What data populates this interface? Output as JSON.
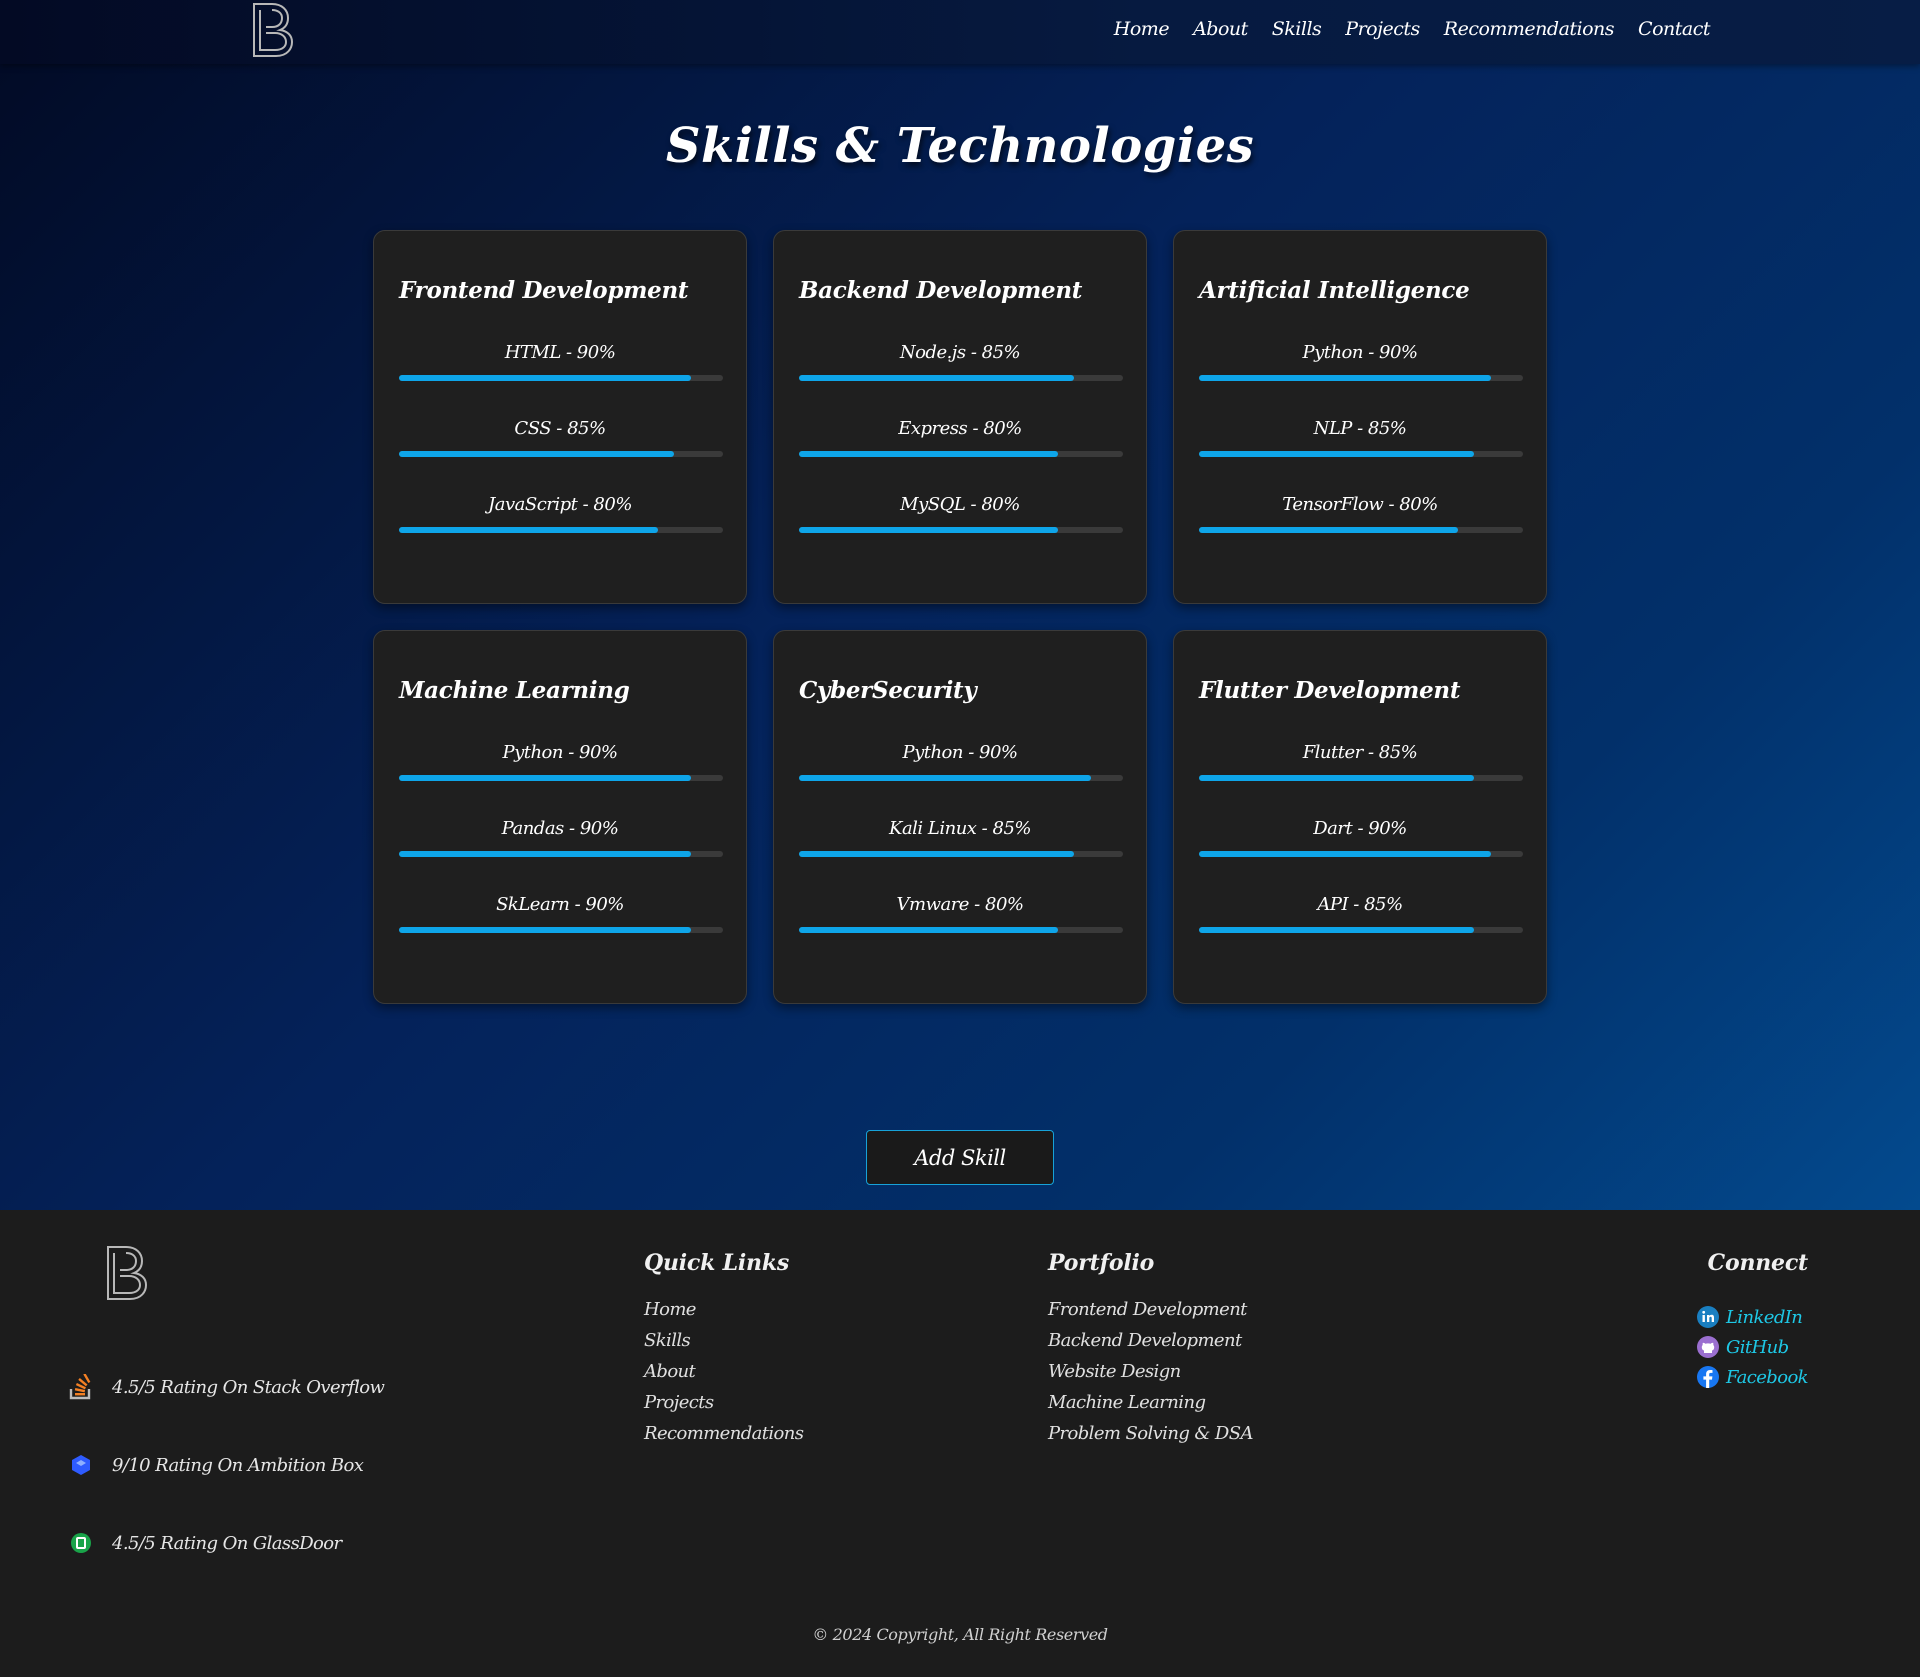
{
  "nav": {
    "logo_icon": "b-monogram-logo",
    "links": [
      "Home",
      "About",
      "Skills",
      "Projects",
      "Recommendations",
      "Contact"
    ]
  },
  "skills_section": {
    "title": "Skills & Technologies",
    "accent_color": "#0ea5e9",
    "cards": [
      {
        "title": "Frontend Development",
        "skills": [
          {
            "label": "HTML - 90%",
            "percent": 90
          },
          {
            "label": "CSS - 85%",
            "percent": 85
          },
          {
            "label": "JavaScript - 80%",
            "percent": 80
          }
        ]
      },
      {
        "title": "Backend Development",
        "skills": [
          {
            "label": "Node.js - 85%",
            "percent": 85
          },
          {
            "label": "Express - 80%",
            "percent": 80
          },
          {
            "label": "MySQL - 80%",
            "percent": 80
          }
        ]
      },
      {
        "title": "Artificial Intelligence",
        "skills": [
          {
            "label": "Python - 90%",
            "percent": 90
          },
          {
            "label": "NLP - 85%",
            "percent": 85
          },
          {
            "label": "TensorFlow - 80%",
            "percent": 80
          }
        ]
      },
      {
        "title": "Machine Learning",
        "skills": [
          {
            "label": "Python - 90%",
            "percent": 90
          },
          {
            "label": "Pandas - 90%",
            "percent": 90
          },
          {
            "label": "SkLearn - 90%",
            "percent": 90
          }
        ]
      },
      {
        "title": "CyberSecurity",
        "skills": [
          {
            "label": "Python - 90%",
            "percent": 90
          },
          {
            "label": "Kali Linux - 85%",
            "percent": 85
          },
          {
            "label": "Vmware - 80%",
            "percent": 80
          }
        ]
      },
      {
        "title": "Flutter Development",
        "skills": [
          {
            "label": "Flutter - 85%",
            "percent": 85
          },
          {
            "label": "Dart - 90%",
            "percent": 90
          },
          {
            "label": "API - 85%",
            "percent": 85
          }
        ]
      }
    ],
    "add_button_label": "Add Skill"
  },
  "footer": {
    "logo_icon": "b-monogram-logo",
    "ratings": [
      {
        "icon": "stack-overflow-icon",
        "text": "4.5/5 Rating On Stack Overflow"
      },
      {
        "icon": "ambition-box-icon",
        "text": "9/10 Rating On Ambition Box"
      },
      {
        "icon": "glassdoor-icon",
        "text": "4.5/5 Rating On GlassDoor"
      }
    ],
    "quick_links": {
      "title": "Quick Links",
      "items": [
        "Home",
        "Skills",
        "About",
        "Projects",
        "Recommendations"
      ]
    },
    "portfolio": {
      "title": "Portfolio",
      "items": [
        "Frontend Development",
        "Backend Development",
        "Website Design",
        "Machine Learning",
        "Problem Solving & DSA"
      ]
    },
    "connect": {
      "title": "Connect",
      "items": [
        {
          "icon": "linkedin-icon",
          "label": "LinkedIn"
        },
        {
          "icon": "github-icon",
          "label": "GitHub"
        },
        {
          "icon": "facebook-icon",
          "label": "Facebook"
        }
      ]
    },
    "copyright": "© 2024 Copyright, All Right Reserved"
  }
}
